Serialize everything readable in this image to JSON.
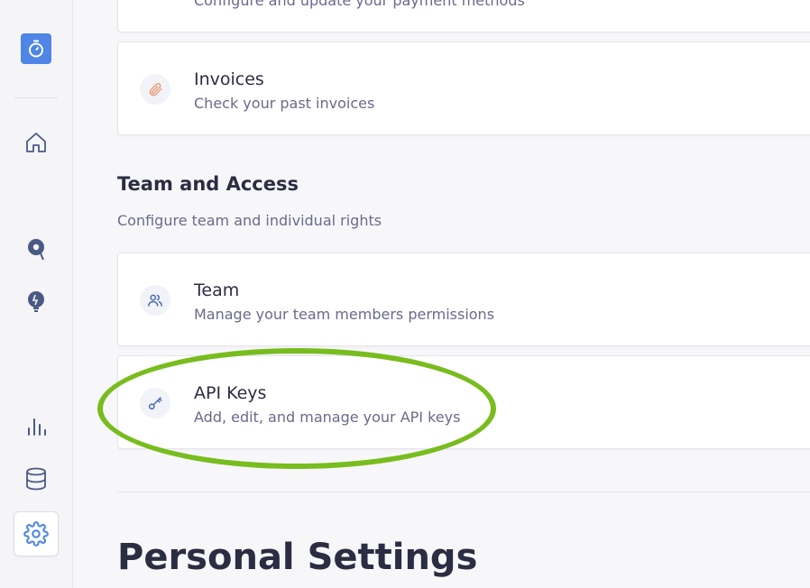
{
  "colors": {
    "accent": "#4f86e6",
    "highlight": "#78bc1e",
    "invoice_icon": "#e8a07a"
  },
  "sidebar": {
    "logo_icon": "stopwatch-icon",
    "items": [
      {
        "icon": "home-icon"
      },
      {
        "icon": "search-location-icon"
      },
      {
        "icon": "lightbulb-icon"
      },
      {
        "icon": "bar-chart-icon"
      },
      {
        "icon": "database-icon"
      },
      {
        "icon": "gear-icon",
        "active": true
      }
    ]
  },
  "billing": {
    "payment_desc": "Configure and update your payment methods",
    "invoices": {
      "title": "Invoices",
      "desc": "Check your past invoices",
      "icon": "paperclip-icon"
    }
  },
  "team_access": {
    "title": "Team and Access",
    "subtitle": "Configure team and individual rights",
    "team": {
      "title": "Team",
      "desc": "Manage your team members permissions",
      "icon": "users-icon"
    },
    "api_keys": {
      "title": "API Keys",
      "desc": "Add, edit, and manage your API keys",
      "icon": "key-icon"
    }
  },
  "personal": {
    "title": "Personal Settings"
  }
}
